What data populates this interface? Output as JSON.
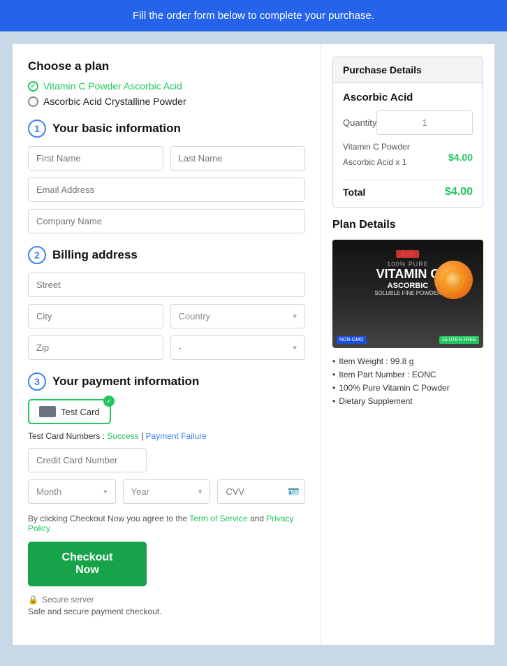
{
  "banner": {
    "text": "Fill the order form below to complete your purchase."
  },
  "left": {
    "choose_plan_title": "Choose a plan",
    "plans": [
      {
        "label": "Vitamin C Powder Ascorbic Acid",
        "selected": true
      },
      {
        "label": "Ascorbic Acid Crystalline Powder",
        "selected": false
      }
    ],
    "step1": {
      "number": "1",
      "title": "Your basic information",
      "first_name_placeholder": "First Name",
      "last_name_placeholder": "Last Name",
      "email_placeholder": "Email Address",
      "company_placeholder": "Company Name"
    },
    "step2": {
      "number": "2",
      "title": "Billing address",
      "street_placeholder": "Street",
      "city_placeholder": "City",
      "country_placeholder": "Country",
      "zip_placeholder": "Zip",
      "state_placeholder": "-"
    },
    "step3": {
      "number": "3",
      "title": "Your payment information",
      "card_label": "Test Card",
      "test_card_label": "Test Card Numbers : ",
      "success_link": "Success",
      "pipe": " | ",
      "failure_link": "Payment Failure",
      "cc_placeholder": "Credit Card Number",
      "month_placeholder": "Month",
      "year_placeholder": "Year",
      "cvv_placeholder": "CVV",
      "tos_text": "By clicking Checkout Now you agree to the ",
      "tos_link": "Term of Service",
      "and_text": " and ",
      "privacy_link": "Privacy Policy",
      "checkout_btn": "Checkout Now",
      "secure_label": "Secure server",
      "safe_label": "Safe and secure payment checkout."
    }
  },
  "right": {
    "purchase_header": "Purchase Details",
    "product_name": "Ascorbic Acid",
    "quantity_label": "Quantity",
    "quantity_value": "1",
    "product_line1": "Vitamin C Powder",
    "product_line2": "Ascorbic Acid x 1",
    "product_price": "$4.00",
    "total_label": "Total",
    "total_price": "$4.00",
    "plan_details_title": "Plan Details",
    "bullets": [
      "Item Weight : 99.8 g",
      "Item Part Number : EONC",
      "100% Pure Vitamin C Powder",
      "Dietary Supplement"
    ]
  }
}
